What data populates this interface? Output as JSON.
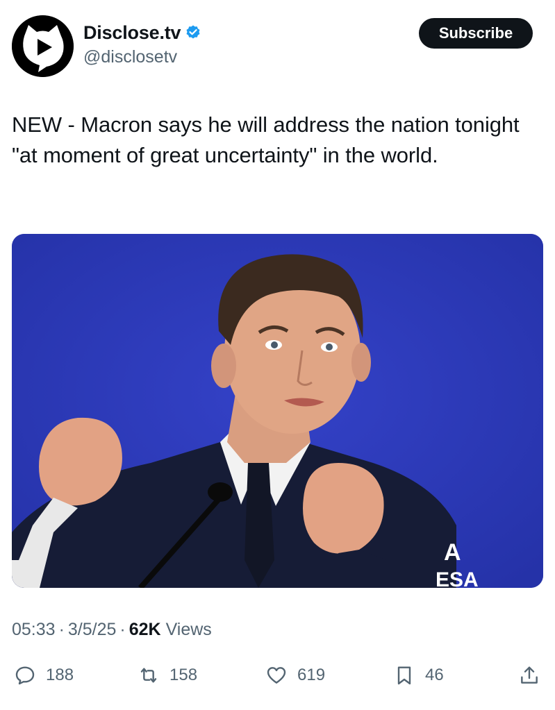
{
  "account": {
    "display_name": "Disclose.tv",
    "handle": "@disclosetv",
    "verified": true,
    "avatar_icon": "play-cat-logo-icon",
    "subscribe_label": "Subscribe"
  },
  "tweet": {
    "text": "NEW - Macron says he will address the nation tonight \"at moment of great uncertainty\" in the world.",
    "media": {
      "description_icon": "photo",
      "background_color": "#2a37b8",
      "corner_text_top": "A",
      "corner_text_bottom": "ESA"
    },
    "time": "05:33",
    "date": "3/5/25",
    "views_count": "62K",
    "views_label": "Views",
    "separator": "·"
  },
  "actions": {
    "reply": {
      "icon": "reply-icon",
      "count": "188"
    },
    "retweet": {
      "icon": "retweet-icon",
      "count": "158"
    },
    "like": {
      "icon": "heart-icon",
      "count": "619"
    },
    "bookmark": {
      "icon": "bookmark-icon",
      "count": "46"
    },
    "share": {
      "icon": "share-icon"
    }
  },
  "colors": {
    "text_primary": "#0f1419",
    "text_secondary": "#536471",
    "verified_blue": "#1d9bf0",
    "button_bg": "#0f1419"
  }
}
